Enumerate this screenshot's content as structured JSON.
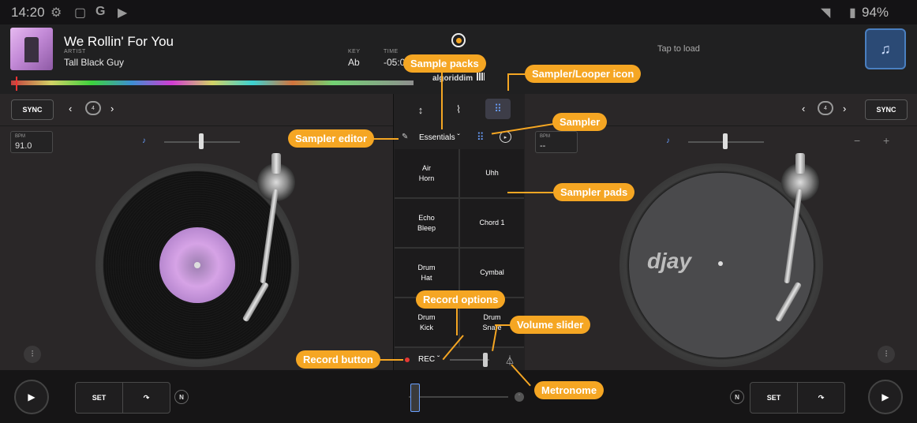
{
  "status_bar": {
    "time": "14:20",
    "battery": "94%",
    "icons": [
      "settings-icon",
      "screenshot-icon",
      "google-icon",
      "play-store-icon",
      "wifi-icon",
      "battery-icon"
    ]
  },
  "track": {
    "title": "We Rollin' For You",
    "artist_label": "ARTIST",
    "artist": "Tall Black Guy",
    "key_label": "KEY",
    "key": "Ab",
    "time_label": "TIME",
    "time": "-05:0",
    "branding": "algoriddim"
  },
  "right_deck_header": {
    "placeholder": "Tap to load"
  },
  "deck_left": {
    "sync_label": "SYNC",
    "loop_value": "4",
    "bpm_label": "BPM",
    "bpm_value": "91.0"
  },
  "deck_right": {
    "sync_label": "SYNC",
    "loop_value": "4",
    "bpm_label": "BPM",
    "bpm_value": "--",
    "minus": "−",
    "plus": "+",
    "platter_logo": "djay"
  },
  "sampler": {
    "pack_name": "Essentials",
    "pads": [
      "Air\nHorn",
      "Uhh",
      "Echo\nBleep",
      "Chord 1",
      "Drum\nHat",
      "Cymbal",
      "Drum\nKick",
      "Drum\nSnare"
    ],
    "rec_label": "REC",
    "volume_level": 0.9
  },
  "transport": {
    "set_label": "SET",
    "n_label": "N"
  },
  "callouts": {
    "sample_packs": "Sample packs",
    "sampler_looper_icon": "Sampler/Looper icon",
    "sampler_editor": "Sampler editor",
    "sampler": "Sampler",
    "sampler_pads": "Sampler pads",
    "record_options": "Record options",
    "volume_slider": "Volume slider",
    "record_button": "Record button",
    "metronome": "Metronome"
  },
  "colors": {
    "accent": "#f5a623",
    "active_tab": "#6aa0ff",
    "record_dot": "#e53935"
  }
}
